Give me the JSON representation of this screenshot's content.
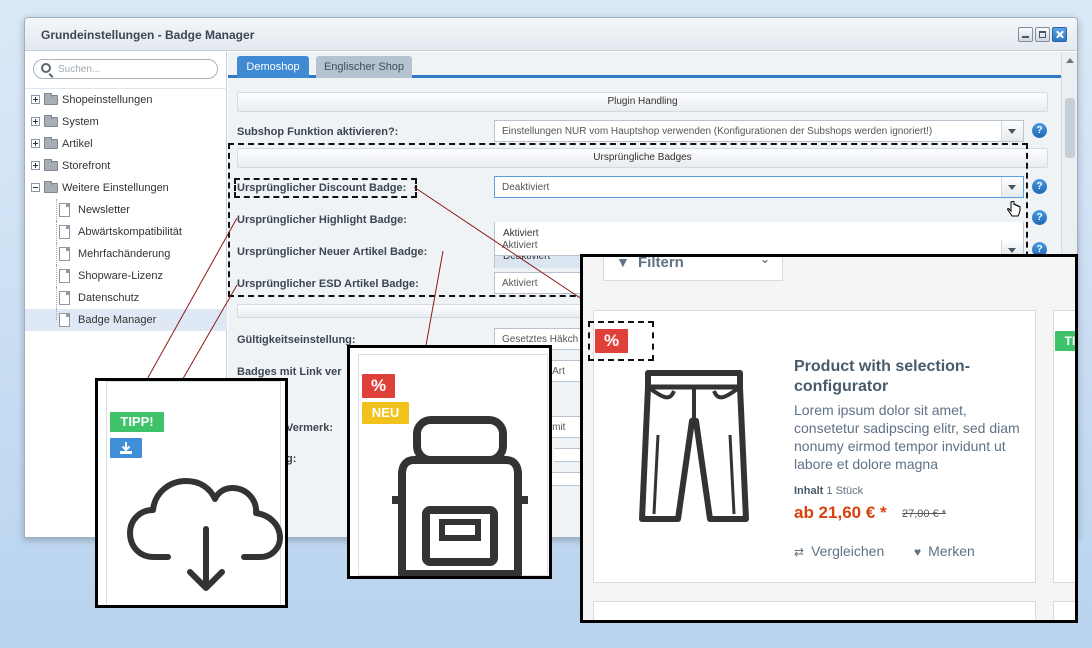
{
  "window": {
    "title": "Grundeinstellungen - Badge Manager"
  },
  "sidebar": {
    "search_placeholder": "Suchen...",
    "items": [
      {
        "label": "Shopeinstellungen"
      },
      {
        "label": "System"
      },
      {
        "label": "Artikel"
      },
      {
        "label": "Storefront"
      },
      {
        "label": "Weitere Einstellungen"
      }
    ],
    "children": [
      {
        "label": "Newsletter"
      },
      {
        "label": "Abwärtskompatibilität"
      },
      {
        "label": "Mehrfachänderung"
      },
      {
        "label": "Shopware-Lizenz"
      },
      {
        "label": "Datenschutz"
      },
      {
        "label": "Badge Manager"
      }
    ]
  },
  "tabs": [
    {
      "label": "Demoshop"
    },
    {
      "label": "Englischer Shop"
    }
  ],
  "form": {
    "section_plugin": "Plugin Handling",
    "subshop_label": "Subshop Funktion aktivieren?:",
    "subshop_value": "Einstellungen NUR vom Hauptshop verwenden (Konfigurationen der Subshops werden ignoriert!)",
    "section_badges": "Ursprüngliche Badges",
    "discount_label": "Ursprünglicher Discount Badge:",
    "discount_value": "Deaktiviert",
    "dropdown_options": [
      "Aktiviert",
      "Deaktiviert"
    ],
    "highlight_label": "Ursprünglicher Highlight Badge:",
    "new_label": "Ursprünglicher Neuer Artikel Badge:",
    "new_value": "Aktiviert",
    "esd_label": "Ursprünglicher ESD Artikel Badge:",
    "esd_value": "Aktiviert",
    "validity_label": "Gültigkeitseinstellung:",
    "validity_value": "Gesetztes Häkch",
    "link_label": "Badges mit Link ver",
    "link_value": "er Art",
    "vermerk_label": "Vermerk:",
    "vermerk_value": "te mit",
    "g_label": "g:",
    "help": "?"
  },
  "callouts": {
    "tipp": "TIPP!",
    "percent": "%",
    "neu": "NEU",
    "download_icon": "download-icon"
  },
  "shop": {
    "filter_label": "Filtern",
    "title": "Product with selection-configurator",
    "description": "Lorem ipsum dolor sit amet, consetetur sadipscing elitr, sed diam nonumy eirmod tempor invidunt ut labore et dolore magna",
    "content_label": "Inhalt",
    "content_value": "1 Stück",
    "price": "ab 21,60 € *",
    "old_price": "27,00 € *",
    "compare_label": "Vergleichen",
    "wishlist_label": "Merken",
    "side_badge": "TI"
  },
  "colors": {
    "accent_blue": "#3f8ad2",
    "badge_green": "#3ec26a",
    "badge_red": "#e0403a",
    "badge_yellow": "#f1c21b",
    "price_orange": "#d9400b",
    "connector_line": "#8b1a1a"
  }
}
